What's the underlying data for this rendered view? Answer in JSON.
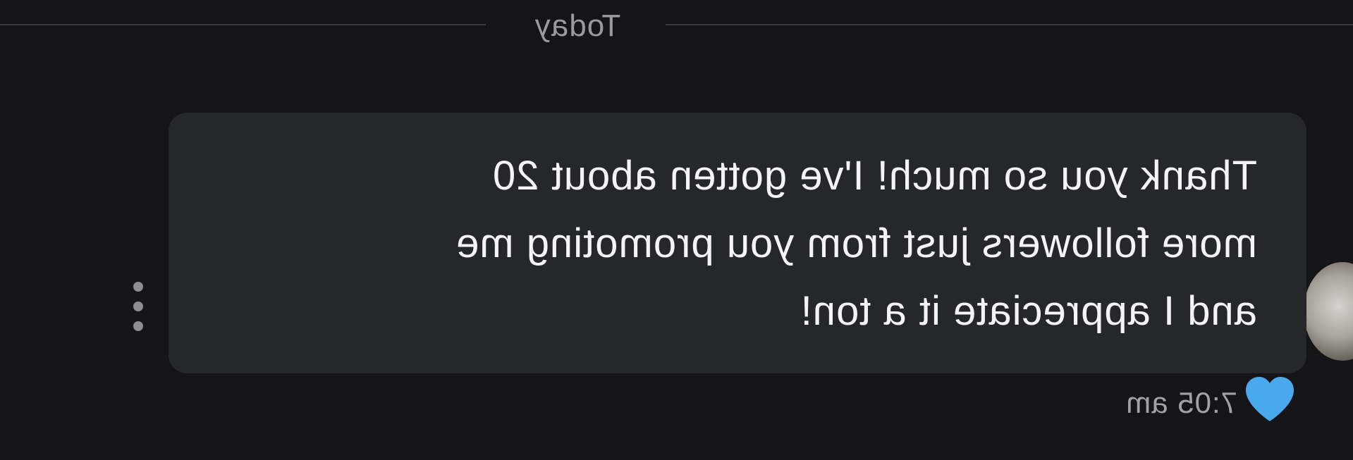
{
  "conversation": {
    "date_divider": "Today",
    "message": {
      "text": "Thank you so much! I've gotten about 20\nmore followers just from you promoting me\nand I appreciate it a ton!",
      "timestamp": "7:05 am",
      "reaction_icon": "heart-icon",
      "more_icon": "more-vertical-icon"
    }
  },
  "colors": {
    "background": "#151517",
    "bubble": "#26272a",
    "text": "#f4f4f6",
    "muted_text": "#a2a2a6",
    "reaction": "#4aa8ec"
  }
}
